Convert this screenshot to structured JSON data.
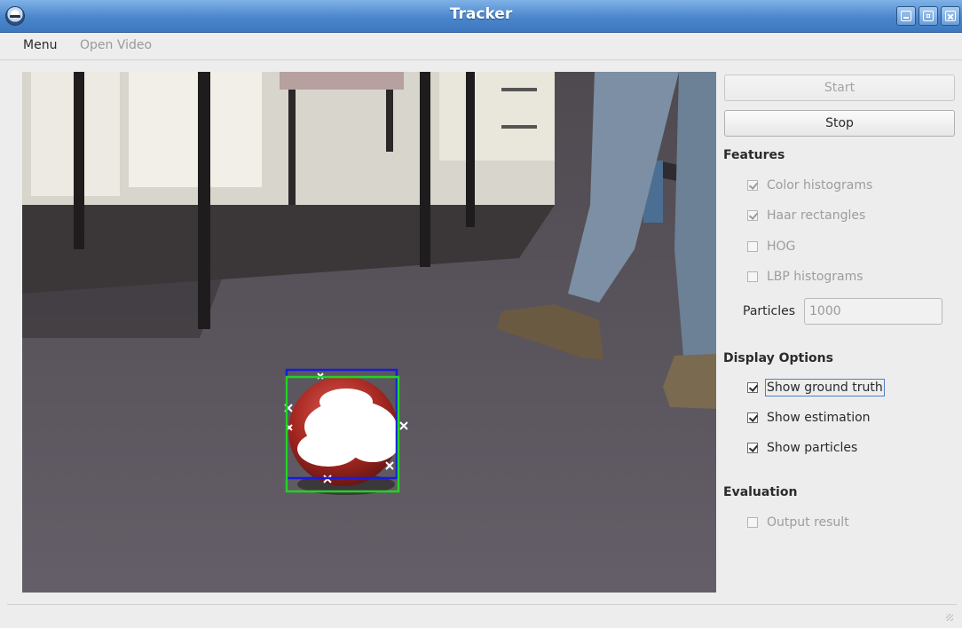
{
  "window": {
    "title": "Tracker"
  },
  "menubar": {
    "menu": "Menu",
    "open_video": "Open Video"
  },
  "controls": {
    "start": "Start",
    "stop": "Stop"
  },
  "features": {
    "heading": "Features",
    "items": [
      {
        "label": "Color histograms",
        "checked": true,
        "enabled": false
      },
      {
        "label": "Haar rectangles",
        "checked": true,
        "enabled": false
      },
      {
        "label": "HOG",
        "checked": false,
        "enabled": false
      },
      {
        "label": "LBP histograms",
        "checked": false,
        "enabled": false
      }
    ],
    "particles_label": "Particles",
    "particles_value": "1000"
  },
  "display": {
    "heading": "Display Options",
    "items": [
      {
        "label": "Show ground truth",
        "checked": true
      },
      {
        "label": "Show estimation",
        "checked": true
      },
      {
        "label": "Show particles",
        "checked": true
      }
    ]
  },
  "evaluation": {
    "heading": "Evaluation",
    "items": [
      {
        "label": "Output result",
        "checked": false,
        "enabled": false
      }
    ]
  },
  "colors": {
    "titlebar": "#4a86cc",
    "ground_truth_box": "#1a1adc",
    "estimation_box": "#21d421",
    "particle": "#ffffff"
  }
}
